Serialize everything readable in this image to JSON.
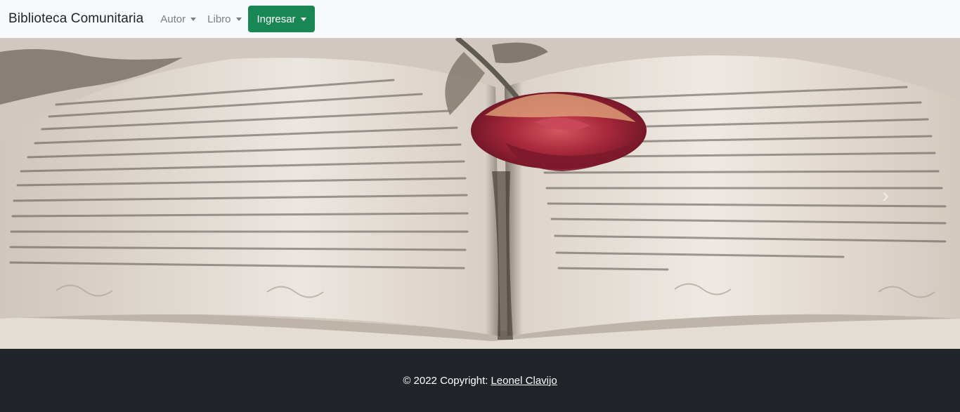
{
  "navbar": {
    "brand": "Biblioteca Comunitaria",
    "menu_autor": "Autor",
    "menu_libro": "Libro",
    "login_button": "Ingresar"
  },
  "hero": {
    "image": "open-book-with-rose",
    "next_icon": "chevron-right-icon"
  },
  "footer": {
    "copyright": "© 2022 Copyright:",
    "author_link": "Leonel Clavijo"
  },
  "colors": {
    "navbar_bg": "#f8f9fa",
    "button_success": "#198754",
    "footer_bg": "#212529"
  }
}
